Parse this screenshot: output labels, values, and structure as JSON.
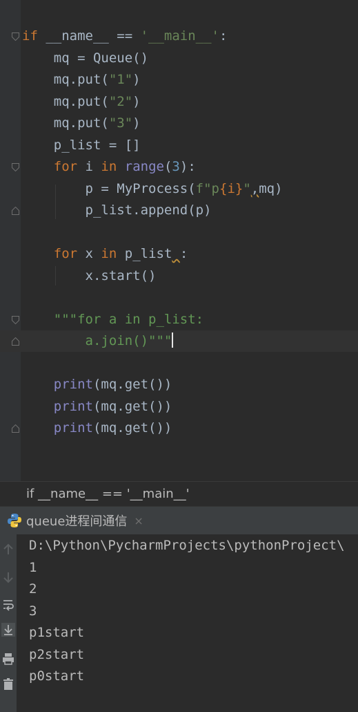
{
  "editor": {
    "lines": [
      {
        "code": [
          {
            "t": "if",
            "c": "kw"
          },
          {
            "t": " __name__ == "
          },
          {
            "t": "'__main__'",
            "c": "str"
          },
          {
            "t": ":"
          }
        ]
      },
      {
        "code": [
          {
            "t": "    mq = Queue()"
          }
        ]
      },
      {
        "code": [
          {
            "t": "    mq.put("
          },
          {
            "t": "\"1\"",
            "c": "str"
          },
          {
            "t": ")"
          }
        ]
      },
      {
        "code": [
          {
            "t": "    mq.put("
          },
          {
            "t": "\"2\"",
            "c": "str"
          },
          {
            "t": ")"
          }
        ]
      },
      {
        "code": [
          {
            "t": "    mq.put("
          },
          {
            "t": "\"3\"",
            "c": "str"
          },
          {
            "t": ")"
          }
        ]
      },
      {
        "code": [
          {
            "t": "    p_list = []"
          }
        ]
      },
      {
        "code": [
          {
            "t": "    "
          },
          {
            "t": "for",
            "c": "kw"
          },
          {
            "t": " i "
          },
          {
            "t": "in",
            "c": "kw"
          },
          {
            "t": " "
          },
          {
            "t": "range",
            "c": "bi"
          },
          {
            "t": "("
          },
          {
            "t": "3",
            "c": "num"
          },
          {
            "t": "):"
          }
        ]
      },
      {
        "code": [
          {
            "t": "        p = MyProcess("
          },
          {
            "t": "f\"p",
            "c": "str"
          },
          {
            "t": "{i}",
            "c": "kw"
          },
          {
            "t": "\"",
            "c": "str"
          },
          {
            "t": ",",
            "c": "squig"
          },
          {
            "t": "mq)"
          }
        ]
      },
      {
        "code": [
          {
            "t": "        p_list.append(p)"
          }
        ]
      },
      {
        "code": []
      },
      {
        "code": [
          {
            "t": "    "
          },
          {
            "t": "for",
            "c": "kw"
          },
          {
            "t": " x "
          },
          {
            "t": "in",
            "c": "kw"
          },
          {
            "t": " p_list"
          },
          {
            "t": " ",
            "c": "squig"
          },
          {
            "t": ":"
          }
        ]
      },
      {
        "code": [
          {
            "t": "        x.start()"
          }
        ]
      },
      {
        "code": []
      },
      {
        "code": [
          {
            "t": "    "
          },
          {
            "t": "\"\"\"for a in p_list:",
            "c": "doc"
          }
        ]
      },
      {
        "code": [
          {
            "t": "        "
          },
          {
            "t": "a.join()\"\"\"",
            "c": "doc"
          }
        ]
      },
      {
        "code": []
      },
      {
        "code": [
          {
            "t": "    "
          },
          {
            "t": "print",
            "c": "bi"
          },
          {
            "t": "(mq.get())"
          }
        ]
      },
      {
        "code": [
          {
            "t": "    "
          },
          {
            "t": "print",
            "c": "bi"
          },
          {
            "t": "(mq.get())"
          }
        ]
      },
      {
        "code": [
          {
            "t": "    "
          },
          {
            "t": "print",
            "c": "bi"
          },
          {
            "t": "(mq.get())"
          },
          {
            "t": "",
            "c": "squig"
          }
        ]
      }
    ]
  },
  "breadcrumb": {
    "text": "if __name__ == '__main__'"
  },
  "run_tab": {
    "label": "queue进程间通信",
    "close": "×",
    "icon": "python-icon"
  },
  "console": {
    "lines": [
      "D:\\Python\\PycharmProjects\\pythonProject\\",
      "1",
      "2",
      "3",
      "p1start",
      "p2start",
      "p0start"
    ]
  }
}
